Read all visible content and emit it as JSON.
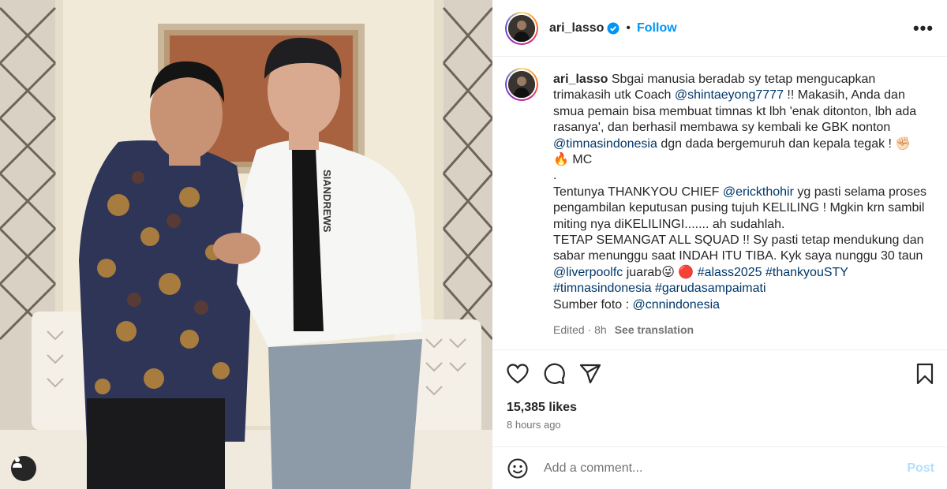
{
  "post": {
    "username": "ari_lasso",
    "follow_label": "Follow",
    "dot": "•",
    "more_label": "•••",
    "caption": [
      {
        "type": "user",
        "text": "ari_lasso"
      },
      {
        "type": "text",
        "text": " Sbgai manusia beradab sy tetap mengucapkan trimakasih utk Coach "
      },
      {
        "type": "link",
        "text": "@shintaeyong7777"
      },
      {
        "type": "text",
        "text": " !! Makasih, Anda dan smua pemain bisa membuat timnas kt lbh 'enak ditonton, lbh ada rasanya', dan berhasil membawa sy kembali ke GBK nonton "
      },
      {
        "type": "link",
        "text": "@timnasindonesia"
      },
      {
        "type": "text",
        "text": " dgn dada bergemuruh dan kepala tegak ! ✊🏻\n🔥 MC\n.\nTentunya THANKYOU CHIEF "
      },
      {
        "type": "link",
        "text": "@erickthohir"
      },
      {
        "type": "text",
        "text": " yg pasti selama proses pengambilan keputusan pusing tujuh KELILING ! Mgkin krn sambil miting nya diKELILINGI....... ah sudahlah.\nTETAP SEMANGAT ALL SQUAD !! Sy pasti tetap mendukung dan sabar menunggu saat INDAH ITU TIBA. Kyk saya nunggu 30 taun\n"
      },
      {
        "type": "link",
        "text": "@liverpoolfc"
      },
      {
        "type": "text",
        "text": " juarab😜 🔴 "
      },
      {
        "type": "link",
        "text": "#alass2025"
      },
      {
        "type": "text",
        "text": " "
      },
      {
        "type": "link",
        "text": "#thankyouSTY"
      },
      {
        "type": "text",
        "text": "\n"
      },
      {
        "type": "link",
        "text": "#timnasindonesia"
      },
      {
        "type": "text",
        "text": " "
      },
      {
        "type": "link",
        "text": "#garudasampaimati"
      },
      {
        "type": "text",
        "text": "\nSumber foto : "
      },
      {
        "type": "link",
        "text": "@cnnindonesia"
      }
    ],
    "edited_label": "Edited · 8h",
    "see_translation": "See translation",
    "likes": "15,385 likes",
    "time_ago": "8 hours ago",
    "comment_placeholder": "Add a comment...",
    "post_label": "Post",
    "photo_jacket_text": "SIANDREWS",
    "colors": {
      "accent": "#0095f6",
      "post_disabled": "#b2dffc",
      "link": "#00376b",
      "verified": "#0095f6",
      "muted": "#737373"
    },
    "icons": {
      "like": "heart-icon",
      "comment": "comment-icon",
      "share": "share-icon",
      "save": "bookmark-icon",
      "emoji": "emoji-icon",
      "tag": "user-tag-icon",
      "more": "more-icon",
      "verified": "verified-badge-icon"
    }
  }
}
